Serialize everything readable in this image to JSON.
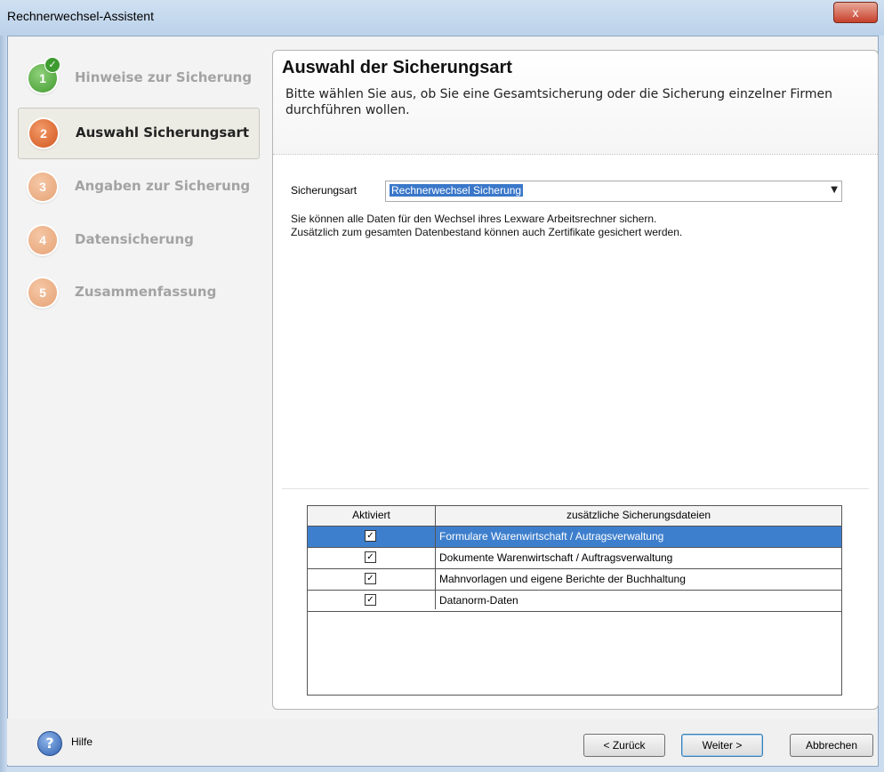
{
  "window": {
    "title": "Rechnerwechsel-Assistent",
    "close_label": "x"
  },
  "steps": [
    {
      "number": "1",
      "label": "Hinweise zur Sicherung",
      "state": "done"
    },
    {
      "number": "2",
      "label": "Auswahl Sicherungsart",
      "state": "current"
    },
    {
      "number": "3",
      "label": "Angaben zur Sicherung",
      "state": "todo"
    },
    {
      "number": "4",
      "label": "Datensicherung",
      "state": "todo"
    },
    {
      "number": "5",
      "label": "Zusammenfassung",
      "state": "todo"
    }
  ],
  "main": {
    "title": "Auswahl der Sicherungsart",
    "description": "Bitte wählen Sie aus, ob Sie eine Gesamtsicherung oder die Sicherung einzelner Firmen durchführen wollen.",
    "field_label": "Sicherungsart",
    "combo_value": "Rechnerwechsel Sicherung",
    "info_line1": "Sie können alle Daten für den Wechsel ihres Lexware Arbeitsrechner sichern.",
    "info_line2": "Zusätzlich zum gesamten Datenbestand können auch Zertifikate gesichert werden."
  },
  "grid": {
    "headers": [
      "Aktiviert",
      "zusätzliche Sicherungsdateien"
    ],
    "rows": [
      {
        "checked": true,
        "label": "Formulare Warenwirtschaft / Autragsverwaltung",
        "selected": true
      },
      {
        "checked": true,
        "label": "Dokumente Warenwirtschaft / Auftragsverwaltung",
        "selected": false
      },
      {
        "checked": true,
        "label": "Mahnvorlagen und eigene Berichte der Buchhaltung",
        "selected": false
      },
      {
        "checked": true,
        "label": "Datanorm-Daten",
        "selected": false
      }
    ]
  },
  "footer": {
    "help_label": "Hilfe",
    "back_label": "< Zurück",
    "next_label": "Weiter >",
    "cancel_label": "Abbrechen"
  },
  "colors": {
    "selection": "#3e7fcd",
    "step_done": "#3f9a2d",
    "step_current": "#d2561c",
    "step_todo": "#e6a274"
  },
  "icons": {
    "help": "help-icon",
    "close": "close-icon",
    "check": "check-icon",
    "dropdown": "chevron-down-icon"
  }
}
